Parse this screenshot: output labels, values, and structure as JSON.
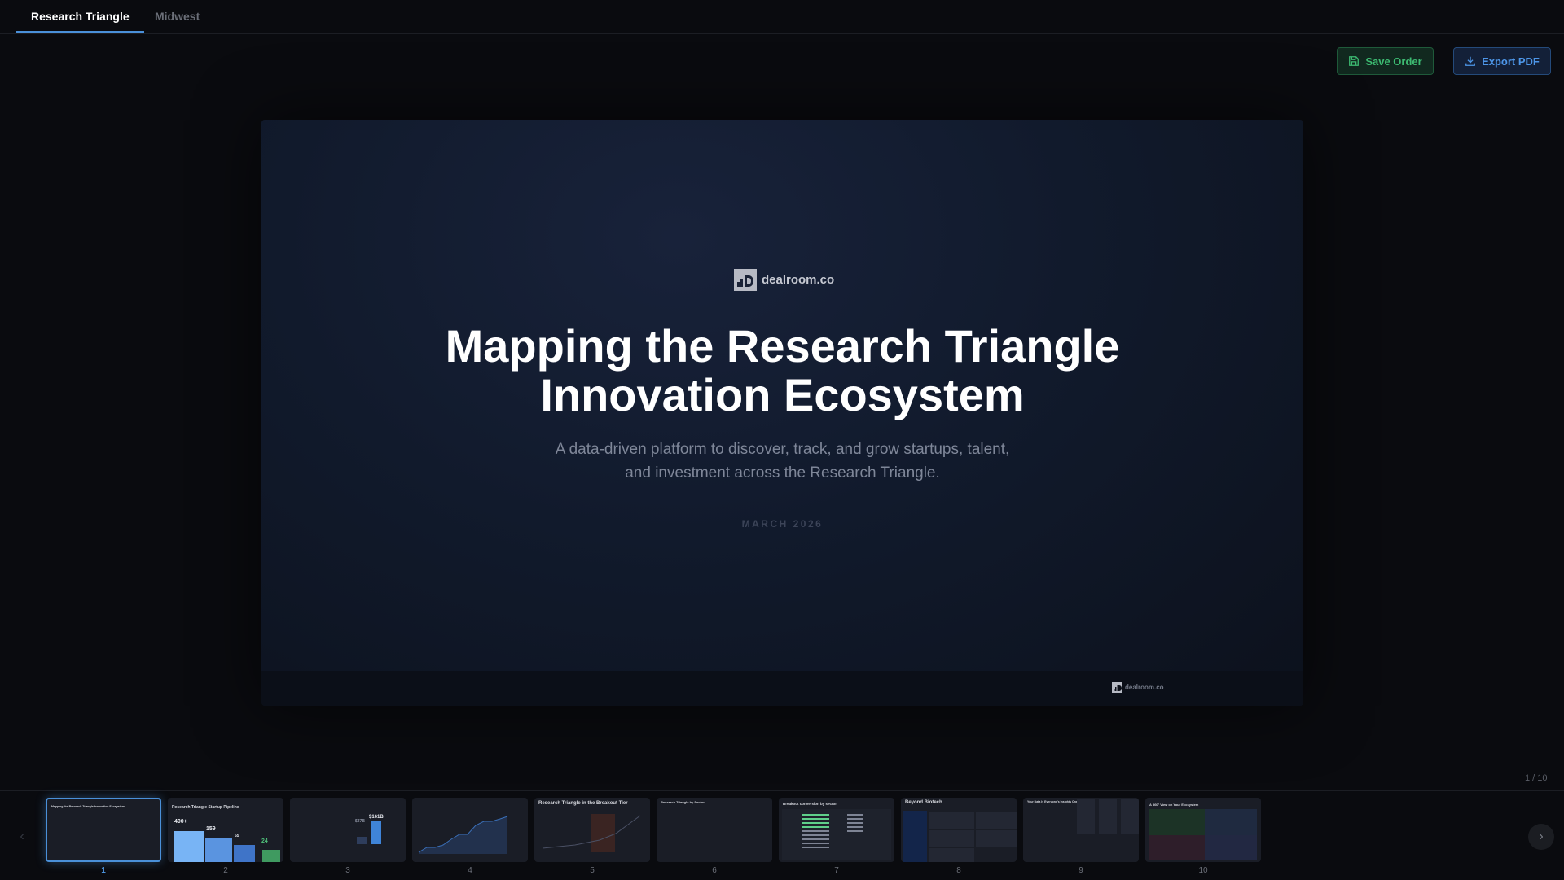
{
  "tabs": [
    {
      "label": "Research Triangle",
      "active": true
    },
    {
      "label": "Midwest",
      "active": false
    }
  ],
  "toolbar": {
    "save_label": "Save Order",
    "export_label": "Export PDF",
    "save_icon": "floppy-disk-icon",
    "export_icon": "download-icon"
  },
  "slide": {
    "logo_text": "dealroom.co",
    "title_line1": "Mapping the Research Triangle",
    "title_line2": "Innovation Ecosystem",
    "subtitle_line1": "A data-driven platform to discover, track, and grow startups, talent,",
    "subtitle_line2": "and investment across the Research Triangle.",
    "date": "MARCH 2026",
    "footer_logo_text": "dealroom.co"
  },
  "page_counter": "1 / 10",
  "filmstrip": {
    "prev_icon": "chevron-left-icon",
    "next_icon": "chevron-right-icon",
    "thumbnails": [
      {
        "number": "1",
        "title": "Mapping the Research Triangle Innovation Ecosystem"
      },
      {
        "number": "2",
        "title": "Research Triangle Startup Pipeline",
        "values": [
          "490+",
          "159",
          "55",
          "24"
        ]
      },
      {
        "number": "3",
        "title": "",
        "values": [
          "$37B",
          "$161B"
        ]
      },
      {
        "number": "4",
        "title": ""
      },
      {
        "number": "5",
        "title": "Research Triangle in the Breakout Tier"
      },
      {
        "number": "6",
        "title": "Research Triangle by Sector"
      },
      {
        "number": "7",
        "title": "Breakout conversion by sector"
      },
      {
        "number": "8",
        "title": "Beyond Biotech"
      },
      {
        "number": "9",
        "title": "Your Data Is Everyone's Insights One"
      },
      {
        "number": "10",
        "title": "A 360° View on Your Ecosystem"
      }
    ]
  },
  "colors": {
    "accent": "#4a90d9",
    "save_green": "#3dbb72",
    "export_blue": "#4d96e8"
  }
}
